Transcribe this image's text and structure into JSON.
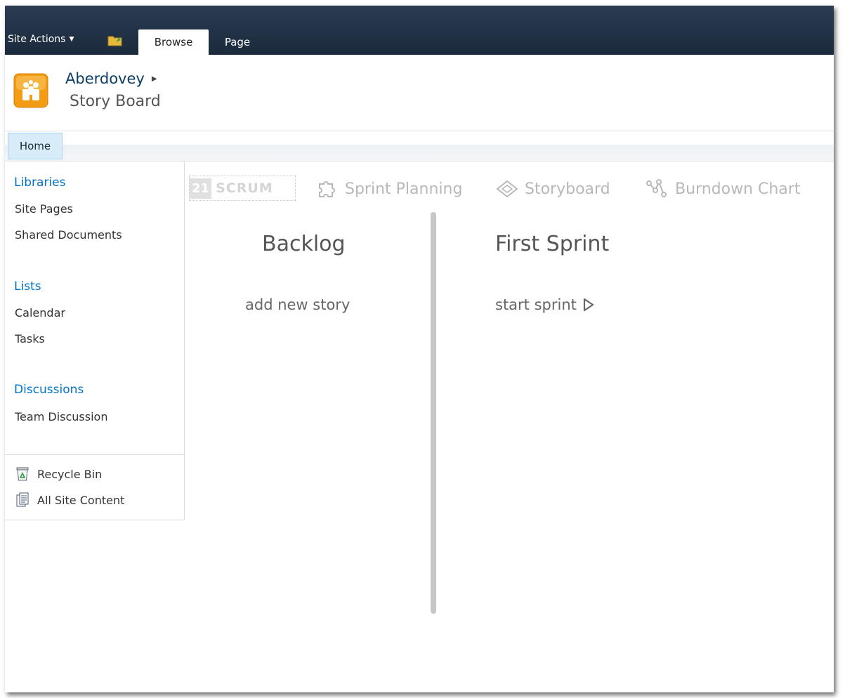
{
  "ribbon": {
    "site_actions_label": "Site Actions",
    "tabs": [
      {
        "label": "Browse",
        "active": true
      },
      {
        "label": "Page",
        "active": false
      }
    ]
  },
  "title_area": {
    "site_name": "Aberdovey",
    "page_name": "Story Board"
  },
  "top_nav": {
    "home_label": "Home"
  },
  "left_nav": {
    "libraries": {
      "heading": "Libraries",
      "items": [
        "Site Pages",
        "Shared Documents"
      ]
    },
    "lists": {
      "heading": "Lists",
      "items": [
        "Calendar",
        "Tasks"
      ]
    },
    "discussions": {
      "heading": "Discussions",
      "items": [
        "Team Discussion"
      ]
    },
    "utilities": {
      "recycle_bin": "Recycle Bin",
      "all_site_content": "All Site Content"
    }
  },
  "scrum_app": {
    "logo_number": "21",
    "logo_word": "SCRUM",
    "nav": {
      "sprint_planning": "Sprint Planning",
      "storyboard": "Storyboard",
      "burndown_chart": "Burndown Chart"
    },
    "backlog": {
      "title": "Backlog",
      "action": "add new story"
    },
    "sprint": {
      "title": "First Sprint",
      "action": "start sprint"
    }
  },
  "colors": {
    "ribbon": "#1f2e42",
    "link_blue": "#0072c6",
    "app_nav_gray": "#b8b8b8"
  }
}
